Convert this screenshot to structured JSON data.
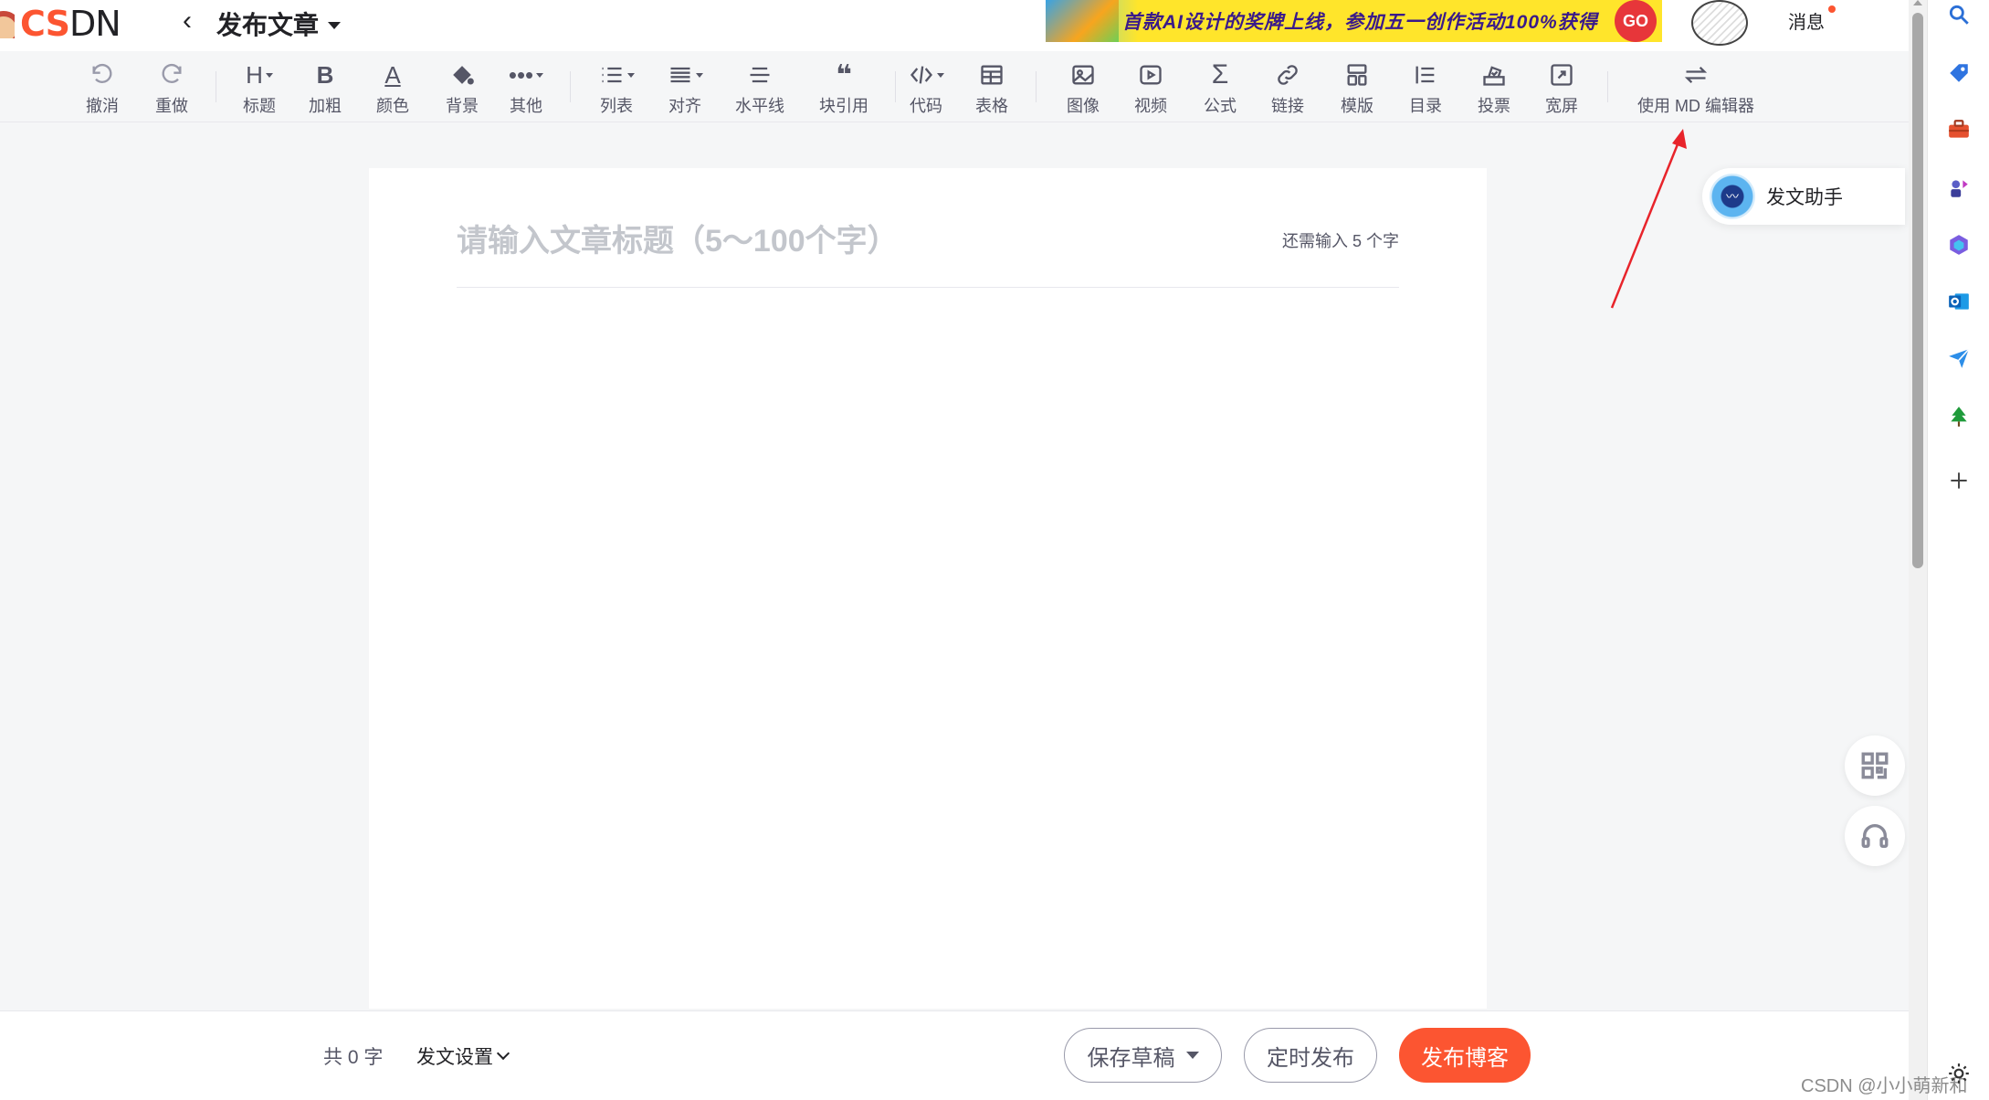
{
  "header": {
    "logo_text_c": "C",
    "logo_text_s": "S",
    "logo_text_dn": "DN",
    "page_title": "发布文章",
    "banner_text": "首款AI设计的奖牌上线，参加五一创作活动100%获得",
    "banner_go": "GO",
    "messages_label": "消息"
  },
  "toolbar": {
    "undo": "撤消",
    "redo": "重做",
    "heading": "标题",
    "bold": "加粗",
    "color": "颜色",
    "background": "背景",
    "other": "其他",
    "list": "列表",
    "align": "对齐",
    "hr": "水平线",
    "quote": "块引用",
    "code": "代码",
    "table": "表格",
    "image": "图像",
    "video": "视频",
    "formula": "公式",
    "link": "链接",
    "template": "模版",
    "toc": "目录",
    "vote": "投票",
    "widescreen": "宽屏",
    "md_editor": "使用 MD 编辑器"
  },
  "editor": {
    "title_placeholder": "请输入文章标题（5～100个字）",
    "title_hint": "还需输入 5 个字"
  },
  "assistant": {
    "label": "发文助手"
  },
  "footer": {
    "word_count": "共 0 字",
    "settings": "发文设置",
    "save_draft": "保存草稿",
    "schedule": "定时发布",
    "publish": "发布博客"
  },
  "watermark": "CSDN @小小萌新和",
  "colors": {
    "accent": "#fc5531",
    "text": "#222226",
    "muted": "#555666"
  }
}
